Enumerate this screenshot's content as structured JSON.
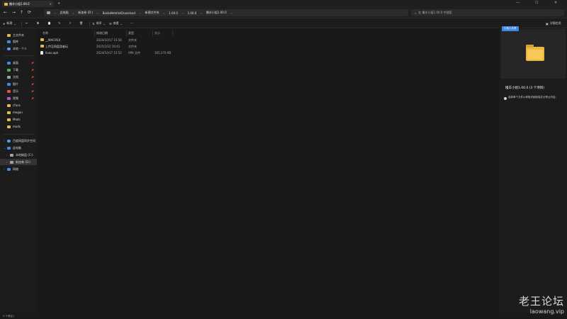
{
  "window": {
    "tab_title": "撸羊小组1.00.0",
    "tab_close": "×",
    "new_tab": "+",
    "min": "—",
    "max": "☐",
    "close": "✕"
  },
  "nav": {
    "back": "←",
    "forward": "→",
    "up": "↑",
    "refresh": "⟳",
    "breadcrumb": [
      "此电脑",
      "新加卷 (D:)",
      "BaiduNetdiskDownload",
      "新建文件夹",
      "1.00.0",
      "1.00.0",
      "撸羊小组1.00.0"
    ],
    "search_placeholder": "在 撸羊小组1.00.0 中搜索"
  },
  "toolbar": {
    "new_label": "新建",
    "sort_label": "排序",
    "view_label": "查看",
    "more_label": "···",
    "details_label": "详细信息"
  },
  "sidebar": {
    "home": "主文件夹",
    "gallery": "图库",
    "onedrive": "本地 - 个人",
    "desktop": "桌面",
    "downloads": "下载",
    "documents": "文档",
    "pictures": "图片",
    "music": "音乐",
    "videos": "视频",
    "f1": "cfuns",
    "f2": "megan",
    "f3": "Mods",
    "f4": "mods",
    "cloud": "百度网盘同步空间",
    "thispc": "此电脑",
    "drive_c": "本地磁盘 (C:)",
    "drive_d": "新加卷 (D:)",
    "network": "网络"
  },
  "columns": {
    "name": "名称",
    "date": "修改日期",
    "type": "类型",
    "size": "大小"
  },
  "files": [
    {
      "name": "__MACOSX",
      "date": "2024/10/17 15:56",
      "type": "文件夹",
      "size": ""
    },
    {
      "name": "上传至网盘游者玩",
      "date": "2025/2/22 16:41",
      "type": "文件夹",
      "size": ""
    },
    {
      "name": "lluoo.apk",
      "date": "2024/10/17 15:52",
      "type": "APK 文件",
      "size": "165,370 KB"
    }
  ],
  "details": {
    "share_btn": "与他人共享",
    "title": "撸羊小组1.00.0 (3 个项目)",
    "info": "选择单个文件以获取详细信息并分享云内容。"
  },
  "status": {
    "text": "3 个项目  |"
  },
  "watermark": {
    "cn": "老王论坛",
    "en": "laowang.vip"
  }
}
